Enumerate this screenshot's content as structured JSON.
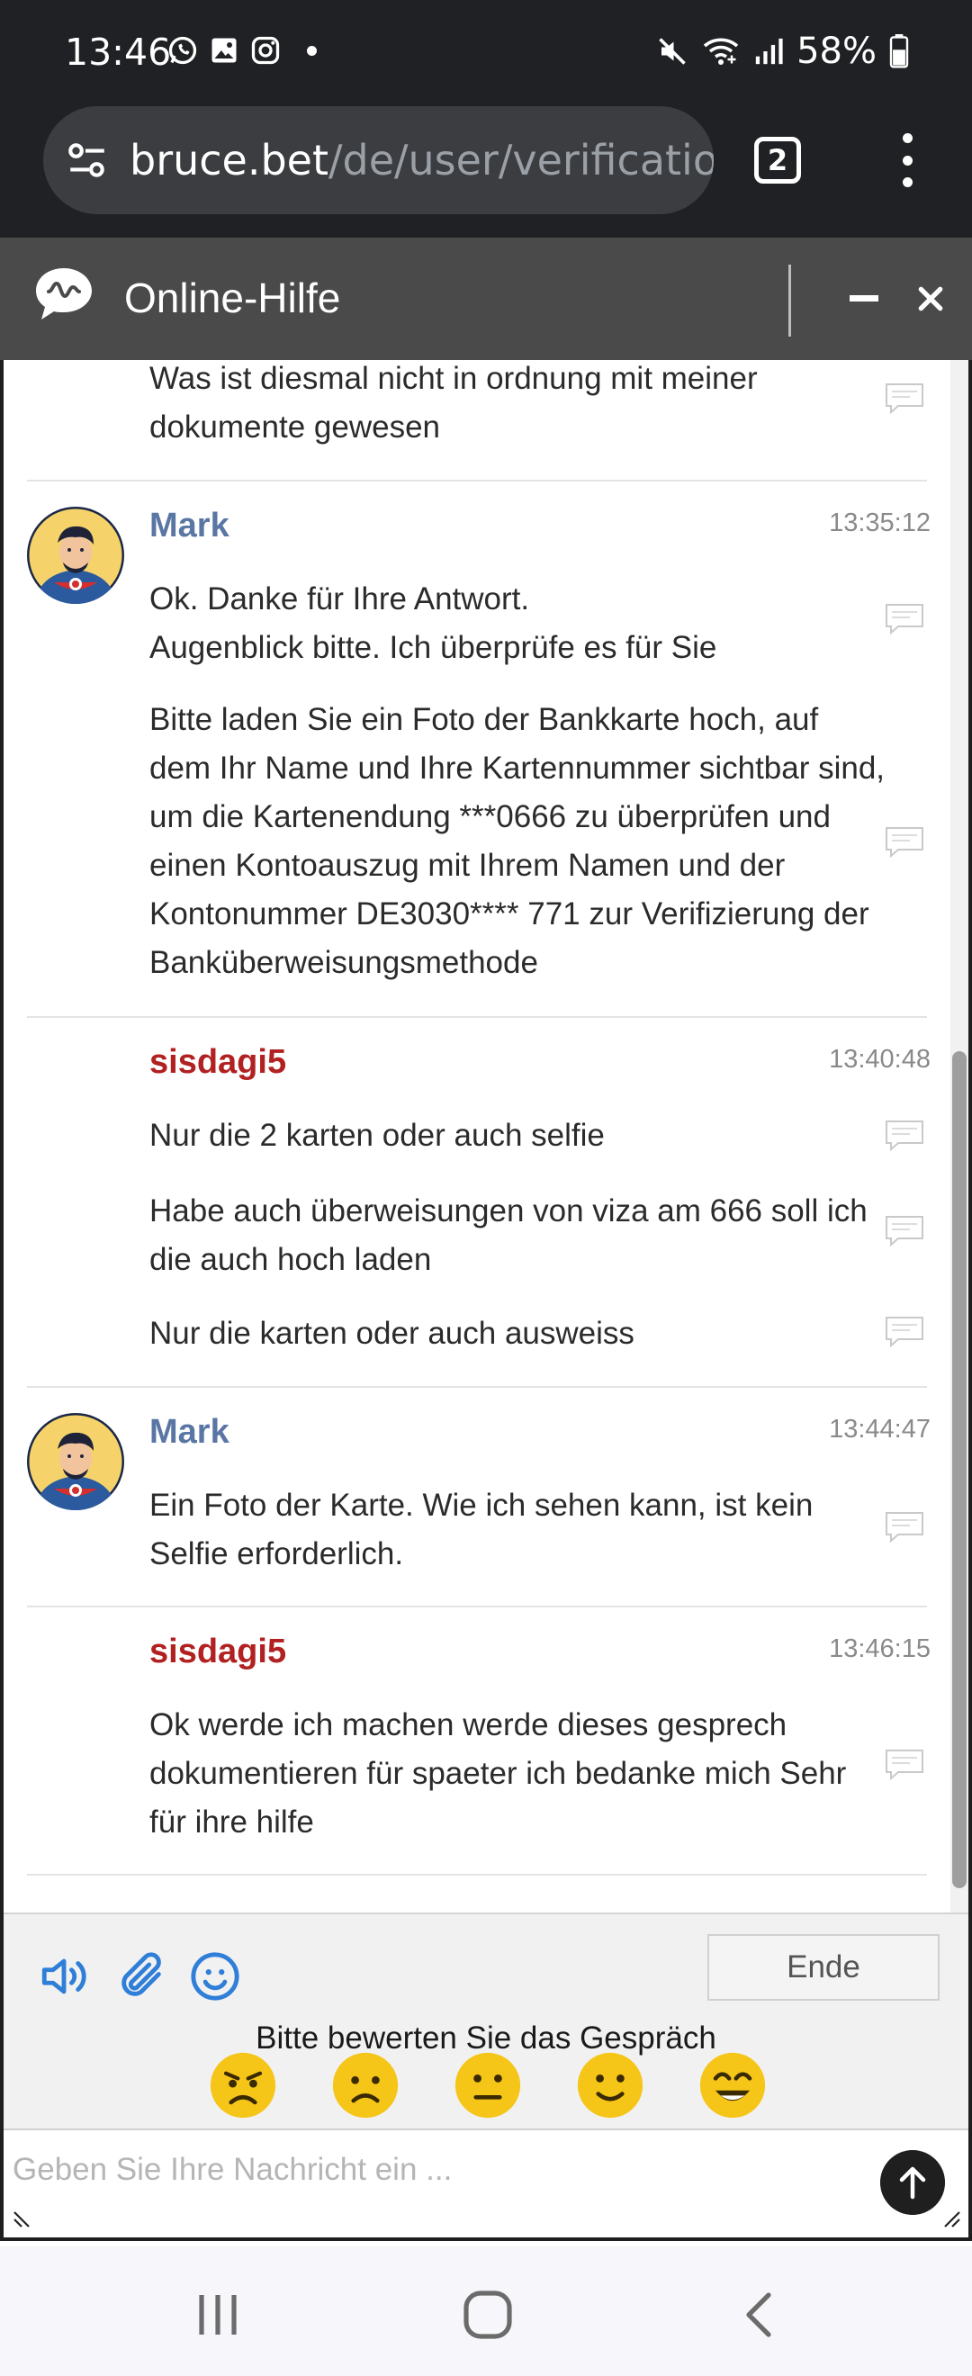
{
  "status_bar": {
    "time": "13:46",
    "battery": "58%",
    "icons_left": [
      "whatsapp-icon",
      "gallery-icon",
      "instagram-icon",
      "dot"
    ],
    "icons_right": [
      "mute-icon",
      "wifi-icon",
      "signal-icon",
      "battery-icon"
    ]
  },
  "browser": {
    "url_host": "bruce.bet",
    "url_path": "/de/user/verification",
    "tab_count": "2"
  },
  "chat": {
    "title": "Online-Hilfe",
    "messages": [
      {
        "author": "",
        "time": "",
        "texts": [
          "Was ist diesmal nicht in ordnung mit meiner dokumente gewesen"
        ]
      },
      {
        "author": "Mark",
        "time": "13:35:12",
        "texts": [
          "Ok. Danke für Ihre Antwort.\nAugenblick bitte. Ich überprüfe es für Sie",
          "Bitte laden Sie ein Foto der Bankkarte hoch, auf dem Ihr Name und Ihre Kartennummer sichtbar sind, um die Kartenendung ***0666 zu überprüfen und einen Kontoauszug mit Ihrem Namen und der Kontonummer DE3030**** 771 zur Verifizierung der Banküberweisungsmethode"
        ]
      },
      {
        "author": "sisdagi5",
        "time": "13:40:48",
        "texts": [
          "Nur die 2 karten oder auch selfie",
          "Habe auch überweisungen von viza am 666 soll ich die auch hoch laden",
          "Nur die karten oder auch ausweiss"
        ]
      },
      {
        "author": "Mark",
        "time": "13:44:47",
        "texts": [
          "Ein Foto der Karte. Wie ich sehen kann, ist kein Selfie erforderlich."
        ]
      },
      {
        "author": "sisdagi5",
        "time": "13:46:15",
        "texts": [
          "Ok werde ich machen werde dieses gesprech dokumentieren für spaeter ich bedanke mich Sehr für ihre hilfe"
        ]
      }
    ],
    "toolbar": {
      "end_label": "Ende",
      "rating_prompt": "Bitte bewerten Sie das Gespräch"
    },
    "input": {
      "placeholder": "Geben Sie Ihre Nachricht ein ...",
      "value": ""
    }
  },
  "colors": {
    "agent_name": "#5a76a4",
    "user_name": "#b22121",
    "header_bg": "#4a4a4a",
    "emoji_yellow": "#f5c518"
  }
}
